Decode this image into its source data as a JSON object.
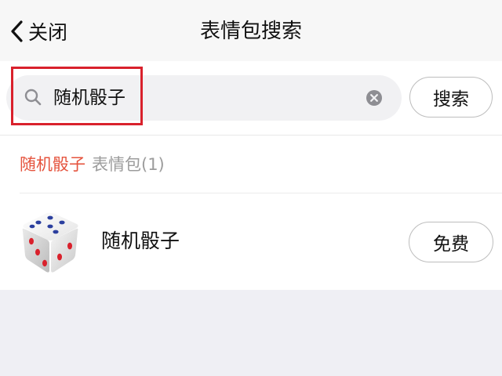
{
  "nav": {
    "back_label": "关闭",
    "title": "表情包搜索"
  },
  "search": {
    "query": "随机骰子",
    "button_label": "搜索",
    "icon": "search-icon",
    "clear_icon": "clear-icon"
  },
  "results": {
    "keyword": "随机骰子",
    "category": "表情包(1)",
    "items": [
      {
        "name": "随机骰子",
        "action_label": "免费",
        "icon": "dice-icon"
      }
    ]
  },
  "colors": {
    "highlight": "#d9212c",
    "keyword": "#e5533d",
    "page_bg": "#efeff4"
  }
}
